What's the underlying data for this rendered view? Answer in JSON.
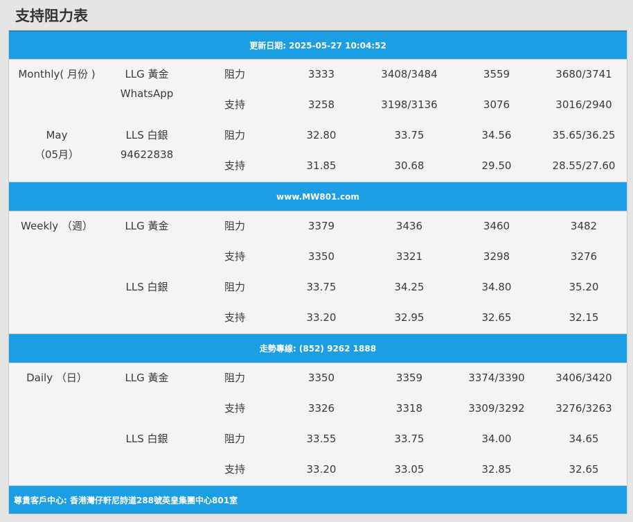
{
  "title": "支持阻力表",
  "bands": {
    "updated": "更新日期: 2025-05-27 10:04:52",
    "website": "www.MW801.com",
    "hotline": "走勢專線: (852) 9262 1888",
    "footer": "尊貴客戶中心: 香港灣仔軒尼詩道288號英皇集團中心801室"
  },
  "groups": [
    {
      "period": [
        "Monthly( 月份 )",
        "May",
        "（05月）"
      ],
      "metals": [
        {
          "name": "LLG 黃金",
          "sub": "WhatsApp",
          "rows": [
            {
              "type": "阻力",
              "values": [
                "3333",
                "3408/3484",
                "3559",
                "3680/3741"
              ]
            },
            {
              "type": "支持",
              "values": [
                "3258",
                "3198/3136",
                "3076",
                "3016/2940"
              ]
            }
          ]
        },
        {
          "name": "LLS 白銀",
          "sub": "94622838",
          "rows": [
            {
              "type": "阻力",
              "values": [
                "32.80",
                "33.75",
                "34.56",
                "35.65/36.25"
              ]
            },
            {
              "type": "支持",
              "values": [
                "31.85",
                "30.68",
                "29.50",
                "28.55/27.60"
              ]
            }
          ]
        }
      ]
    },
    {
      "period": [
        "Weekly （週）"
      ],
      "metals": [
        {
          "name": "LLG 黃金",
          "sub": "",
          "rows": [
            {
              "type": "阻力",
              "values": [
                "3379",
                "3436",
                "3460",
                "3482"
              ]
            },
            {
              "type": "支持",
              "values": [
                "3350",
                "3321",
                "3298",
                "3276"
              ]
            }
          ]
        },
        {
          "name": "LLS 白銀",
          "sub": "",
          "rows": [
            {
              "type": "阻力",
              "values": [
                "33.75",
                "34.25",
                "34.80",
                "35.20"
              ]
            },
            {
              "type": "支持",
              "values": [
                "33.20",
                "32.95",
                "32.65",
                "32.15"
              ]
            }
          ]
        }
      ]
    },
    {
      "period": [
        "Daily （日）"
      ],
      "metals": [
        {
          "name": "LLG 黃金",
          "sub": "",
          "rows": [
            {
              "type": "阻力",
              "values": [
                "3350",
                "3359",
                "3374/3390",
                "3406/3420"
              ]
            },
            {
              "type": "支持",
              "values": [
                "3326",
                "3318",
                "3309/3292",
                "3276/3263"
              ]
            }
          ]
        },
        {
          "name": "LLS 白銀",
          "sub": "",
          "rows": [
            {
              "type": "阻力",
              "values": [
                "33.55",
                "33.75",
                "34.00",
                "34.65"
              ]
            },
            {
              "type": "支持",
              "values": [
                "33.20",
                "33.05",
                "32.85",
                "32.65"
              ]
            }
          ]
        }
      ]
    }
  ]
}
